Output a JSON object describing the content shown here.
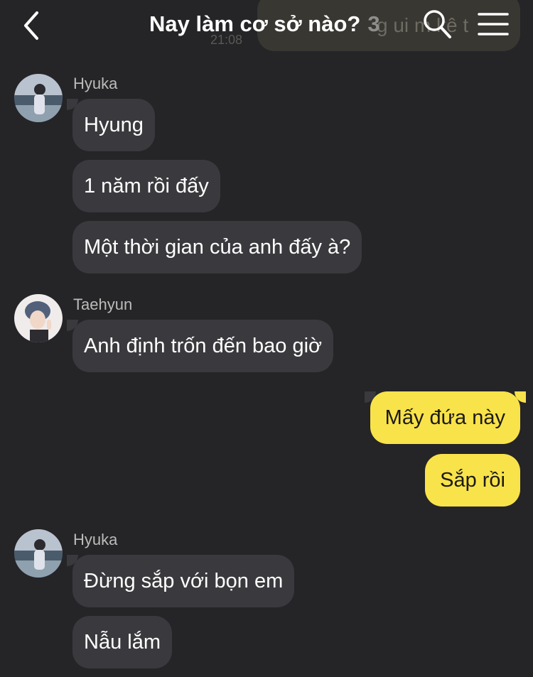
{
  "header": {
    "title": "Nay làm cơ sở nào?",
    "member_count": "3",
    "back_icon": "chevron-left-icon",
    "search_icon": "search-icon",
    "menu_icon": "menu-icon"
  },
  "background_preview": {
    "text": "g   ui m   kê t",
    "time": "21:08"
  },
  "messages": [
    {
      "sender": "Hyuka",
      "texts": [
        "Hyung",
        "1 năm rồi đấy",
        "Một thời gian của anh đấy à?"
      ]
    },
    {
      "sender": "Taehyun",
      "texts": [
        "Anh định trốn đến bao giờ"
      ]
    },
    {
      "sender": "me",
      "texts": [
        "Mấy đứa này",
        "Sắp rồi"
      ]
    },
    {
      "sender": "Hyuka",
      "texts": [
        "Đừng sắp với bọn em",
        "Nẫu lắm"
      ]
    }
  ],
  "colors": {
    "background": "#252427",
    "incoming_bubble": "#3a393d",
    "outgoing_bubble": "#f9e34a"
  }
}
